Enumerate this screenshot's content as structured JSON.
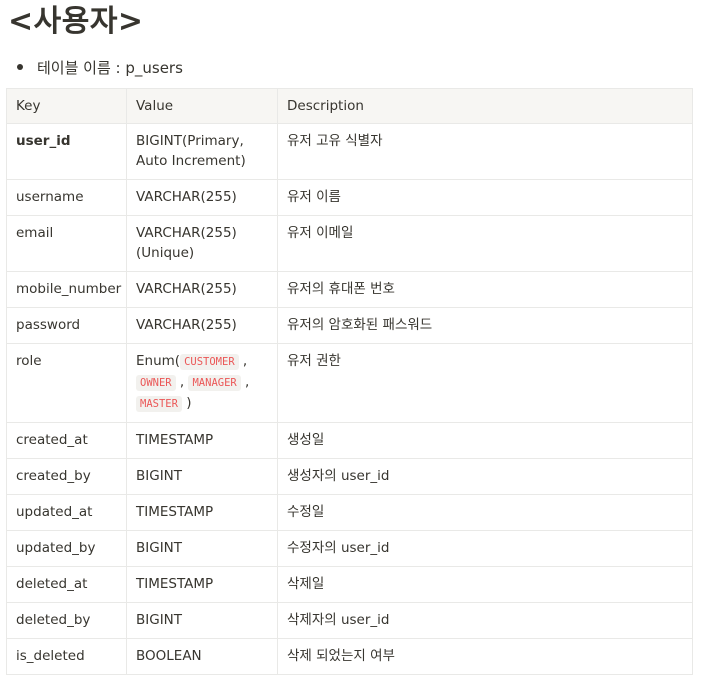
{
  "heading": "<사용자>",
  "bullet": "테이블 이름 : p_users",
  "columns": [
    "Key",
    "Value",
    "Description"
  ],
  "rows": [
    {
      "key": "user_id",
      "value": "BIGINT(Primary, Auto Increment)",
      "desc": "유저 고유 식별자"
    },
    {
      "key": "username",
      "value": "VARCHAR(255)",
      "desc": "유저 이름"
    },
    {
      "key": "email",
      "value": "VARCHAR(255) (Unique)",
      "desc": "유저 이메일"
    },
    {
      "key": "mobile_number",
      "value": "VARCHAR(255)",
      "desc": "유저의 휴대폰 번호"
    },
    {
      "key": "password",
      "value": "VARCHAR(255)",
      "desc": "유저의 암호화된 패스워드"
    },
    {
      "key": "role",
      "value_prefix": "Enum(",
      "enum_values": [
        "CUSTOMER",
        "OWNER",
        "MANAGER",
        "MASTER"
      ],
      "value_suffix": ")",
      "desc": "유저 권한"
    },
    {
      "key": "created_at",
      "value": "TIMESTAMP",
      "desc": "생성일"
    },
    {
      "key": "created_by",
      "value": "BIGINT",
      "desc": "생성자의 user_id"
    },
    {
      "key": "updated_at",
      "value": "TIMESTAMP",
      "desc": "수정일"
    },
    {
      "key": "updated_by",
      "value": "BIGINT",
      "desc": "수정자의 user_id"
    },
    {
      "key": "deleted_at",
      "value": "TIMESTAMP",
      "desc": "삭제일"
    },
    {
      "key": "deleted_by",
      "value": "BIGINT",
      "desc": "삭제자의 user_id"
    },
    {
      "key": "is_deleted",
      "value": "BOOLEAN",
      "desc": "삭제 되었는지 여부"
    }
  ]
}
